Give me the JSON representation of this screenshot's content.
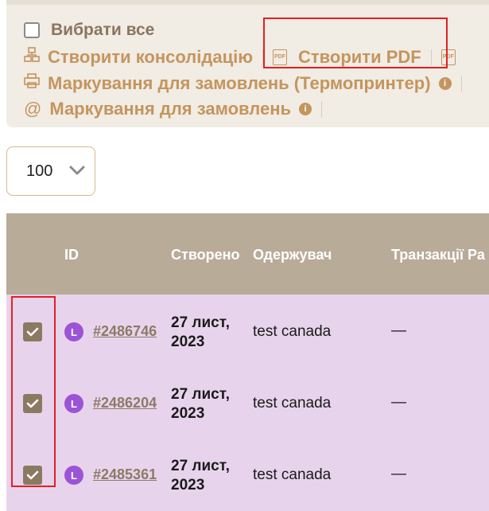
{
  "toolbar": {
    "select_all": "Вибрати все",
    "consolidation": "Створити консолідацію",
    "create_pdf": "Створити PDF",
    "thermal_label": "Маркування для замовлень (Термопринтер)",
    "order_label": "Маркування для замовлень",
    "pdf_icon_text": "PDF"
  },
  "per_page": {
    "value": "100"
  },
  "table": {
    "columns": [
      "ID",
      "Створено",
      "Одержувач",
      "Транзакції Ра"
    ],
    "rows": [
      {
        "badge": "L",
        "id": "#2486746",
        "created_line1": "27 лист,",
        "created_line2": "2023",
        "recipient": "test canada",
        "transactions": "—",
        "checked": true
      },
      {
        "badge": "L",
        "id": "#2486204",
        "created_line1": "27 лист,",
        "created_line2": "2023",
        "recipient": "test canada",
        "transactions": "—",
        "checked": true
      },
      {
        "badge": "L",
        "id": "#2485361",
        "created_line1": "27 лист,",
        "created_line2": "2023",
        "recipient": "test canada",
        "transactions": "—",
        "checked": true
      }
    ]
  },
  "colors": {
    "accent": "#c4955e",
    "header": "#b8ab98",
    "row_bg": "#e7d4ec",
    "badge": "#9c54d6",
    "highlight": "#e32020"
  }
}
